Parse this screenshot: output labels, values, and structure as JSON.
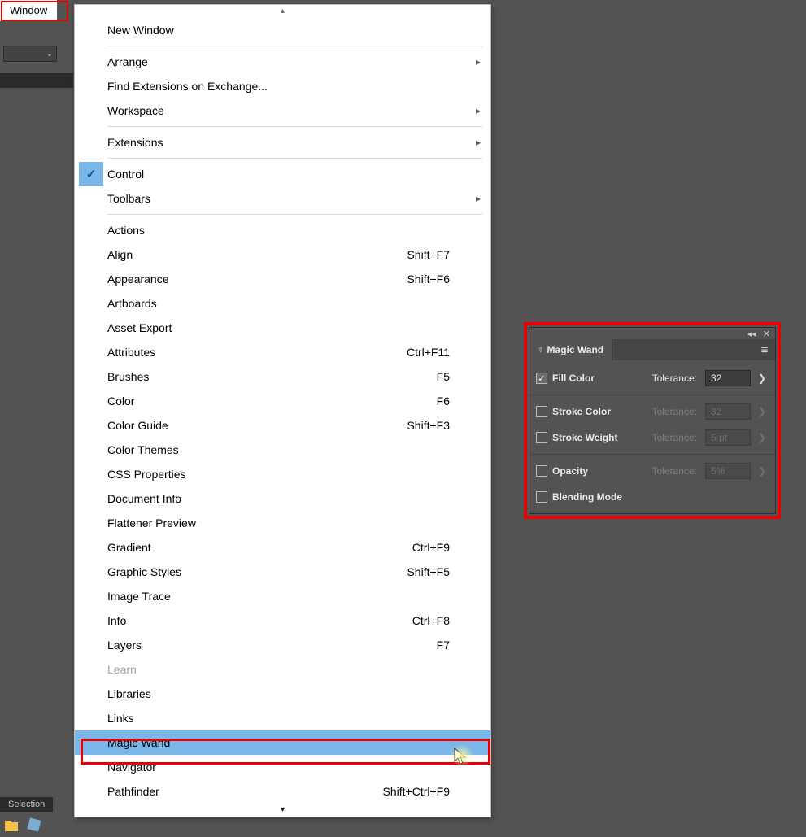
{
  "menubar": {
    "window": "Window"
  },
  "menu": {
    "scroll_up": "▴",
    "scroll_down": "▾",
    "items": [
      {
        "label": "New Window",
        "shortcut": "",
        "type": "item"
      },
      {
        "type": "sep"
      },
      {
        "label": "Arrange",
        "shortcut": "",
        "type": "submenu"
      },
      {
        "label": "Find Extensions on Exchange...",
        "shortcut": "",
        "type": "item"
      },
      {
        "label": "Workspace",
        "shortcut": "",
        "type": "submenu"
      },
      {
        "type": "sep"
      },
      {
        "label": "Extensions",
        "shortcut": "",
        "type": "submenu"
      },
      {
        "type": "sep"
      },
      {
        "label": "Control",
        "shortcut": "",
        "type": "item",
        "checked": true
      },
      {
        "label": "Toolbars",
        "shortcut": "",
        "type": "submenu"
      },
      {
        "type": "sep"
      },
      {
        "label": "Actions",
        "shortcut": "",
        "type": "item"
      },
      {
        "label": "Align",
        "shortcut": "Shift+F7",
        "type": "item"
      },
      {
        "label": "Appearance",
        "shortcut": "Shift+F6",
        "type": "item"
      },
      {
        "label": "Artboards",
        "shortcut": "",
        "type": "item"
      },
      {
        "label": "Asset Export",
        "shortcut": "",
        "type": "item"
      },
      {
        "label": "Attributes",
        "shortcut": "Ctrl+F11",
        "type": "item"
      },
      {
        "label": "Brushes",
        "shortcut": "F5",
        "type": "item"
      },
      {
        "label": "Color",
        "shortcut": "F6",
        "type": "item"
      },
      {
        "label": "Color Guide",
        "shortcut": "Shift+F3",
        "type": "item"
      },
      {
        "label": "Color Themes",
        "shortcut": "",
        "type": "item"
      },
      {
        "label": "CSS Properties",
        "shortcut": "",
        "type": "item"
      },
      {
        "label": "Document Info",
        "shortcut": "",
        "type": "item"
      },
      {
        "label": "Flattener Preview",
        "shortcut": "",
        "type": "item"
      },
      {
        "label": "Gradient",
        "shortcut": "Ctrl+F9",
        "type": "item"
      },
      {
        "label": "Graphic Styles",
        "shortcut": "Shift+F5",
        "type": "item"
      },
      {
        "label": "Image Trace",
        "shortcut": "",
        "type": "item"
      },
      {
        "label": "Info",
        "shortcut": "Ctrl+F8",
        "type": "item"
      },
      {
        "label": "Layers",
        "shortcut": "F7",
        "type": "item"
      },
      {
        "label": "Learn",
        "shortcut": "",
        "type": "item",
        "disabled": true
      },
      {
        "label": "Libraries",
        "shortcut": "",
        "type": "item"
      },
      {
        "label": "Links",
        "shortcut": "",
        "type": "item"
      },
      {
        "label": "Magic Wand",
        "shortcut": "",
        "type": "item",
        "highlight": true
      },
      {
        "label": "Navigator",
        "shortcut": "",
        "type": "item"
      },
      {
        "label": "Pathfinder",
        "shortcut": "Shift+Ctrl+F9",
        "type": "item"
      }
    ]
  },
  "selection_tab": "Selection",
  "panel": {
    "collapse_icon": "◂◂",
    "close_icon": "✕",
    "tab_title": "Magic Wand",
    "menu_icon": "≡",
    "rows": {
      "fill": {
        "label": "Fill Color",
        "tol_label": "Tolerance:",
        "value": "32",
        "checked": true,
        "enabled": true
      },
      "stroke": {
        "label": "Stroke Color",
        "tol_label": "Tolerance:",
        "value": "32",
        "checked": false,
        "enabled": false
      },
      "weight": {
        "label": "Stroke Weight",
        "tol_label": "Tolerance:",
        "value": "5 pt",
        "checked": false,
        "enabled": false
      },
      "opacity": {
        "label": "Opacity",
        "tol_label": "Tolerance:",
        "value": "5%",
        "checked": false,
        "enabled": false
      },
      "blend": {
        "label": "Blending Mode",
        "checked": false
      }
    },
    "chevron": "❯",
    "check_glyph": "✓",
    "updown_glyph": "⇕"
  }
}
